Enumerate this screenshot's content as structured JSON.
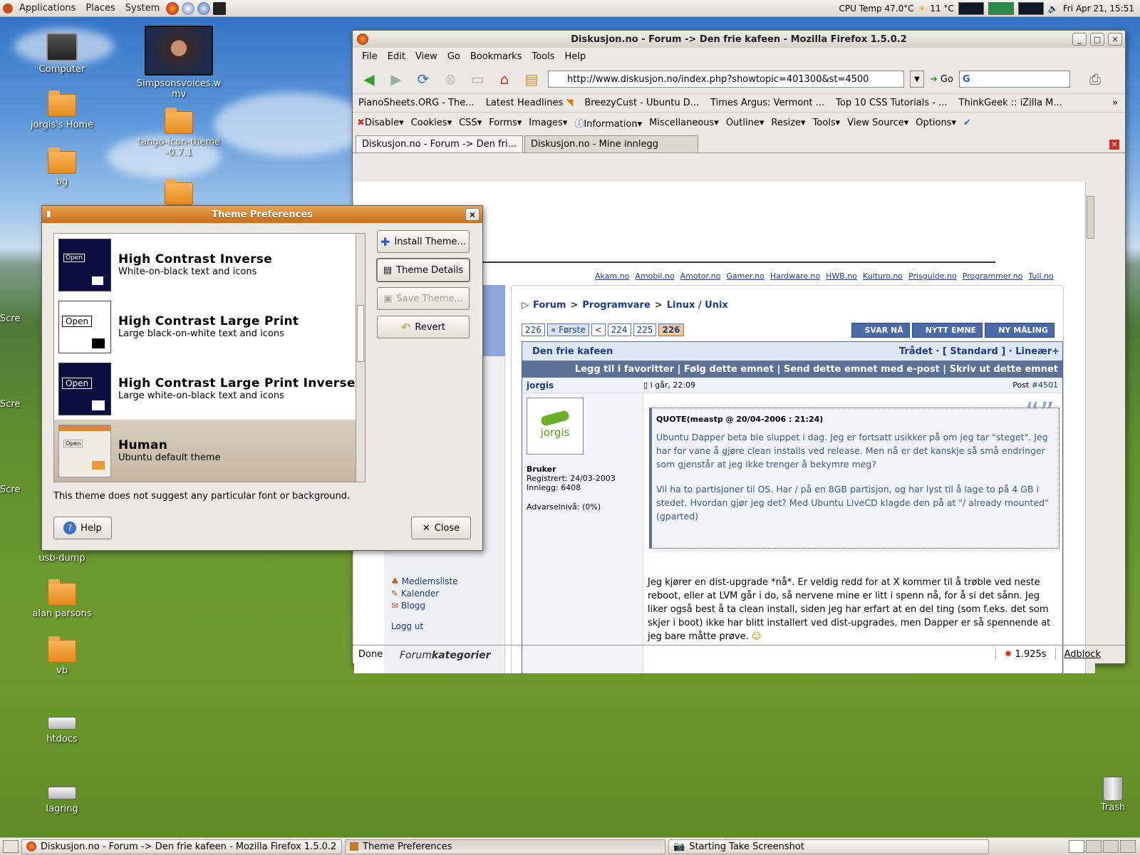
{
  "top_panel": {
    "menus": [
      "Applications",
      "Places",
      "System"
    ],
    "cpu_temp": "CPU Temp 47.0°C",
    "weather": "11 °C",
    "clock": "Fri Apr 21, 15:51"
  },
  "desktop_icons": [
    {
      "label": "Computer"
    },
    {
      "label": "jorgis's Home"
    },
    {
      "label": "bg"
    },
    {
      "label": "Simpsonsvoices.wmv"
    },
    {
      "label": "tango-icon-theme-0.7.1"
    },
    {
      "label": "usb-dump"
    },
    {
      "label": "alan parsons"
    },
    {
      "label": "vb"
    },
    {
      "label": "htdocs"
    },
    {
      "label": "lagring"
    },
    {
      "label": "Trash"
    },
    {
      "label": "Scre"
    }
  ],
  "firefox": {
    "title": "Diskusjon.no - Forum -> Den frie kafeen - Mozilla Firefox 1.5.0.2",
    "menu": [
      "File",
      "Edit",
      "View",
      "Go",
      "Bookmarks",
      "Tools",
      "Help"
    ],
    "url": "http://www.diskusjon.no/index.php?showtopic=401300&st=4500",
    "go_label": "Go",
    "bookmarks": [
      "PianoSheets.ORG - The...",
      "Latest Headlines",
      "BreezyCust - Ubuntu D...",
      "Times Argus: Vermont ...",
      "Top 10 CSS Tutorials - ...",
      "ThinkGeek :: iZilla M..."
    ],
    "webdev": [
      "Disable",
      "Cookies",
      "CSS",
      "Forms",
      "Images",
      "Information",
      "Miscellaneous",
      "Outline",
      "Resize",
      "Tools",
      "View Source",
      "Options"
    ],
    "tabs": [
      "Diskusjon.no - Forum -> Den fri...",
      "Diskusjon.no - Mine innlegg"
    ],
    "status": "Done",
    "load_time": "1.925s",
    "adblock": "Adblock"
  },
  "forum": {
    "site_links": [
      "Akam.no",
      "Amobil.no",
      "Amotor.no",
      "Gamer.no",
      "Hardware.no",
      "HWB.no",
      "Kulturo.no",
      "Prisguide.no",
      "Programmer.no",
      "Tull.no"
    ],
    "breadcrumb": [
      "Forum",
      ">",
      "Programvare",
      ">",
      "Linux / Unix"
    ],
    "pages": [
      "226",
      "« Første",
      "<",
      "224",
      "225",
      "226"
    ],
    "action_buttons": [
      "SVAR NÅ",
      "NYTT EMNE",
      "NY MÅLING"
    ],
    "topic_title": "Den frie kafeen",
    "view_modes": "Trådet · [ Standard ] · Lineær+",
    "topic_actions": "Legg til i favoritter | Følg dette emnet | Send dette emnet med e-post | Skriv ut dette emnet",
    "author": "jorgis",
    "avatar_text": "jorgis",
    "post_time": "i går, 22:09",
    "post_label": "Post",
    "post_number": "#4501",
    "group": "Bruker",
    "registered": "Registrert: 24/03-2003",
    "posts": "Innlegg: 6408",
    "warn": "Advarselnivå: (0%)",
    "quote_header": "QUOTE(meastp @ 20/04-2006 : 21:24)",
    "quote_p1": "Ubuntu Dapper beta ble sluppet i dag. Jeg er fortsatt usikker på om jeg tar \"steget\". Jeg har for vane å gjøre clean installs ved release. Men nå er det kanskje så små endringer som gjenstår at jeg ikke trenger å bekymre meg?",
    "quote_p2": "Vil ha to partisjoner til OS. Har / på en 8GB partisjon, og har lyst til å lage to på 4 GB i stedet. Hvordan gjør jeg det? Med Ubuntu LiveCD klagde den på at \"/ already mounted\" (gparted)",
    "body": "Jeg kjører en dist-upgrade *nå*. Er veldig redd for at X kommer til å trøble ved neste reboot, eller at LVM går i do, så nervene mine er litt i spenn nå, for å si det sånn. Jeg liker også best å ta clean install, siden jeg har erfart at en del ting (som f.eks. det som skjer i boot) ikke har blitt installert ved dist-upgrades, men Dapper er så spennende at jeg bare måtte prøve.",
    "side_links": [
      "Medlemsliste",
      "Kalender",
      "Blogg",
      "Logg ut"
    ],
    "side_heading_a": "Forum",
    "side_heading_b": "kategorier"
  },
  "dialog": {
    "title": "Theme Preferences",
    "themes": [
      {
        "name": "High Contrast Inverse",
        "desc": "White-on-black text and icons"
      },
      {
        "name": "High Contrast Large Print",
        "desc": "Large black-on-white text and icons"
      },
      {
        "name": "High Contrast Large Print Inverse",
        "desc": "Large white-on-black text and icons"
      },
      {
        "name": "Human",
        "desc": "Ubuntu default theme"
      }
    ],
    "thumb_open": "Open",
    "install": "Install Theme...",
    "details": "Theme Details",
    "save": "Save Theme...",
    "revert": "Revert",
    "note": "This theme does not suggest any particular font or background.",
    "help": "Help",
    "close": "Close"
  },
  "taskbar": [
    "Diskusjon.no - Forum -> Den frie kafeen - Mozilla Firefox 1.5.0.2",
    "Theme Preferences",
    "Starting Take Screenshot"
  ]
}
